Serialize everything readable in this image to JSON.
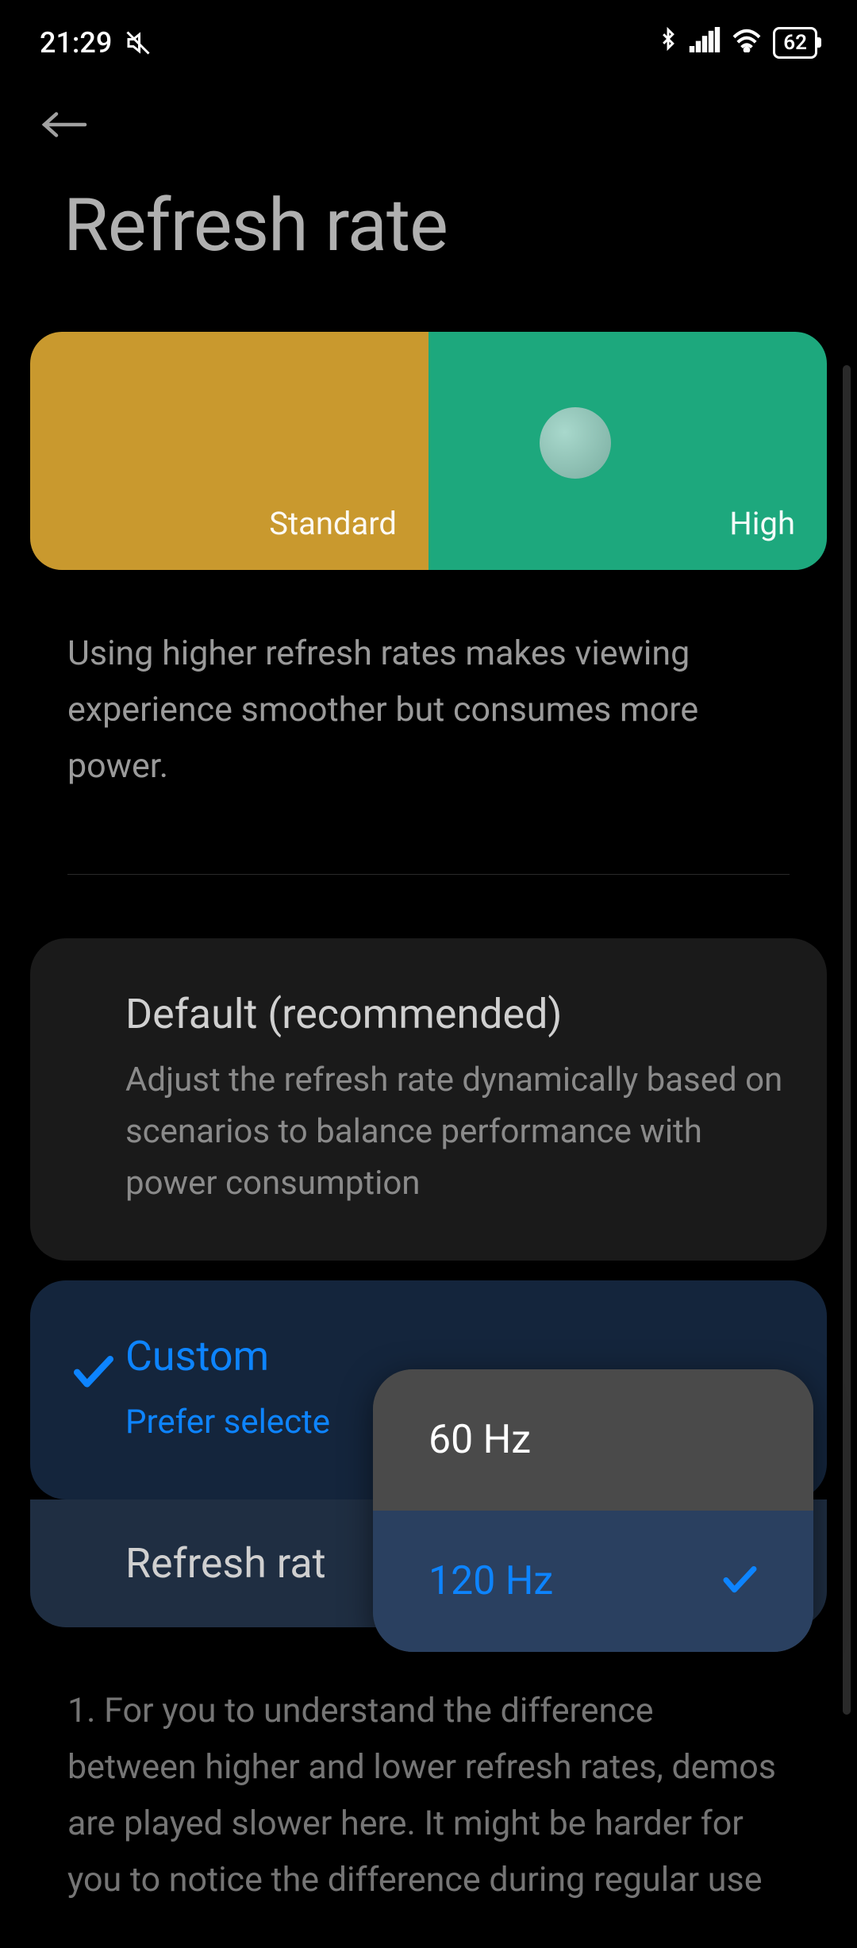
{
  "status_bar": {
    "time": "21:29",
    "battery": "62"
  },
  "header": {
    "title": "Refresh rate"
  },
  "demo": {
    "standard_label": "Standard",
    "high_label": "High"
  },
  "description": "Using higher refresh rates makes viewing experience smoother but consumes more power.",
  "options": {
    "default": {
      "title": "Default (recommended)",
      "subtitle": "Adjust the refresh rate dynamically based on scenarios to balance performance with power consumption"
    },
    "custom": {
      "title": "Custom",
      "subtitle": "Prefer selecte"
    },
    "refresh_rate_row": "Refresh rat"
  },
  "dropdown": {
    "option_60": "60 Hz",
    "option_120": "120 Hz"
  },
  "footer": "1. For you to understand the difference between higher and lower refresh rates, demos are played slower here. It might be harder for you to notice the difference during regular use"
}
